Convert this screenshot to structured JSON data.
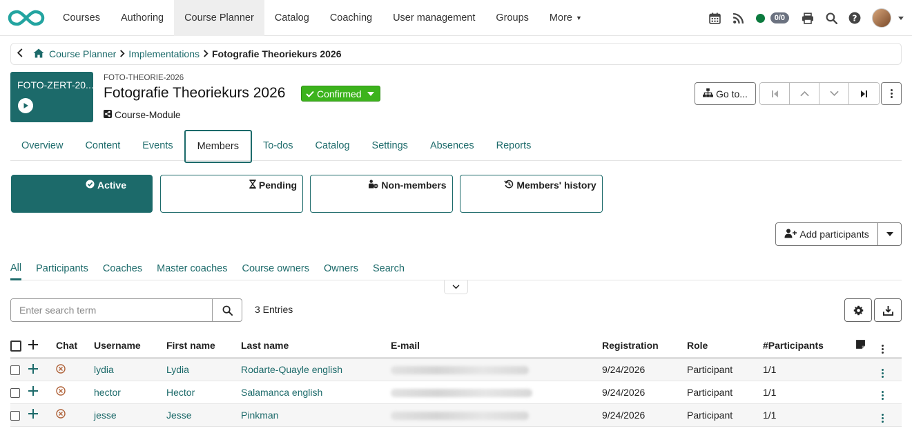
{
  "nav": {
    "items": [
      "Courses",
      "Authoring",
      "Course Planner",
      "Catalog",
      "Coaching",
      "User management",
      "Groups"
    ],
    "more": "More",
    "counter": "0/0"
  },
  "breadcrumb": {
    "root": "Course Planner",
    "parent": "Implementations",
    "current": "Fotografie Theoriekurs 2026"
  },
  "course": {
    "thumb_title": "FOTO-ZERT-20...",
    "code": "FOTO-THEORIE-2026",
    "title": "Fotografie Theoriekurs 2026",
    "status": "Confirmed",
    "type": "Course-Module",
    "goto_label": "Go to..."
  },
  "tabs": [
    "Overview",
    "Content",
    "Events",
    "Members",
    "To-dos",
    "Catalog",
    "Settings",
    "Absences",
    "Reports"
  ],
  "member_panels": {
    "active": "Active",
    "pending": "Pending",
    "non_members": "Non-members",
    "history": "Members' history"
  },
  "add_participants": "Add participants",
  "subtabs": [
    "All",
    "Participants",
    "Coaches",
    "Master coaches",
    "Course owners",
    "Owners",
    "Search"
  ],
  "search": {
    "placeholder": "Enter search term",
    "entries": "3 Entries"
  },
  "table": {
    "headers": {
      "chat": "Chat",
      "username": "Username",
      "first_name": "First name",
      "last_name": "Last name",
      "email": "E-mail",
      "registration": "Registration",
      "role": "Role",
      "participants": "#Participants"
    },
    "rows": [
      {
        "username": "lydia",
        "first_name": "Lydia",
        "last_name": "Rodarte-Quayle english",
        "registration": "9/24/2026",
        "role": "Participant",
        "participants": "1/1"
      },
      {
        "username": "hector",
        "first_name": "Hector",
        "last_name": "Salamanca english",
        "registration": "9/24/2026",
        "role": "Participant",
        "participants": "1/1"
      },
      {
        "username": "jesse",
        "first_name": "Jesse",
        "last_name": "Pinkman",
        "registration": "9/24/2026",
        "role": "Participant",
        "participants": "1/1"
      }
    ]
  },
  "colors": {
    "brand": "#1c6a6a",
    "status_green": "#3cb31c",
    "presence_green": "#0b7a3e"
  }
}
